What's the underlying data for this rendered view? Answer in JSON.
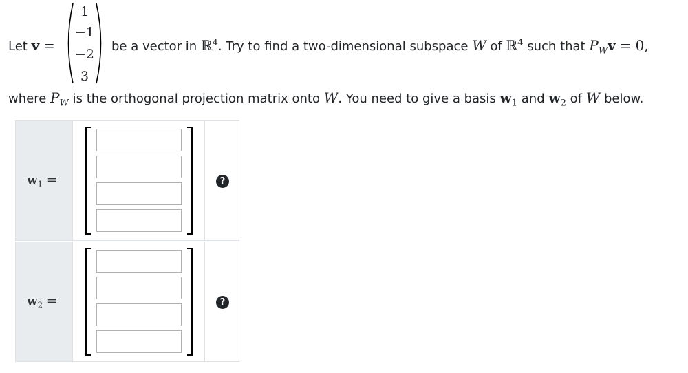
{
  "problem": {
    "let_text": "Let",
    "v_symbol": "v",
    "equals": "=",
    "vector_entries": [
      "1",
      "−1",
      "−2",
      "3"
    ],
    "sentence_part1": "be a vector in",
    "R_symbol": "ℝ",
    "dim_exponent": "4",
    "sentence_part2": ". Try to find a two-dimensional subspace",
    "W_symbol": "W",
    "of_text": "of",
    "such_that_text": "such that",
    "P_symbol": "P",
    "P_sub": "W",
    "projection_rhs": "= 0,",
    "line2_where": "where",
    "line2_part1": "is the orthogonal projection matrix onto",
    "line2_part2": ". You need to give a basis",
    "w1_symbol": "w",
    "w1_sub": "1",
    "and_text": "and",
    "w2_symbol": "w",
    "w2_sub": "2",
    "of_text2": "of",
    "below_text": "below."
  },
  "rows": [
    {
      "label_symbol": "w",
      "label_sub": "1",
      "equals": "=",
      "input_values": [
        "",
        "",
        "",
        ""
      ],
      "help_glyph": "?"
    },
    {
      "label_symbol": "w",
      "label_sub": "2",
      "equals": "=",
      "input_values": [
        "",
        "",
        "",
        ""
      ],
      "help_glyph": "?"
    }
  ]
}
